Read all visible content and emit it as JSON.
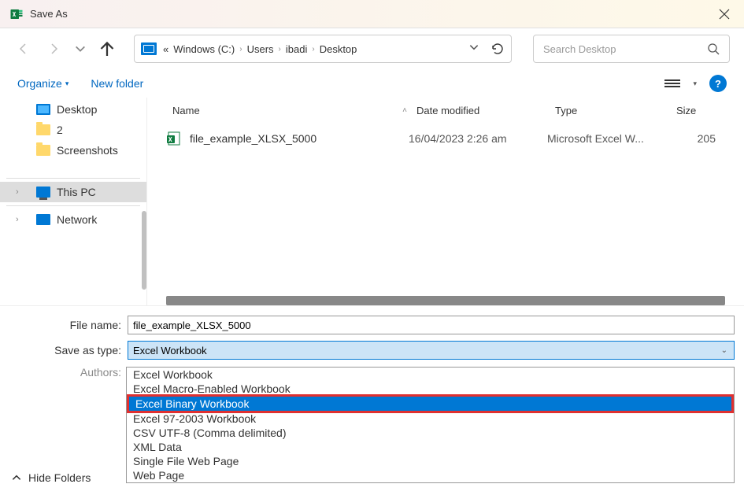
{
  "window": {
    "title": "Save As"
  },
  "nav": {
    "crumb_prefix": "«",
    "crumbs": [
      "Windows (C:)",
      "Users",
      "ibadi",
      "Desktop"
    ]
  },
  "search": {
    "placeholder": "Search Desktop"
  },
  "toolbar": {
    "organize": "Organize",
    "new_folder": "New folder"
  },
  "sidebar": {
    "items_top": [
      {
        "label": "Desktop",
        "icon": "desktop"
      },
      {
        "label": "2",
        "icon": "folder"
      },
      {
        "label": "Screenshots",
        "icon": "folder"
      }
    ],
    "items_bottom": [
      {
        "label": "This PC",
        "icon": "pc",
        "selected": true,
        "expand": true
      },
      {
        "label": "Network",
        "icon": "net",
        "expand": true
      }
    ]
  },
  "columns": {
    "name": "Name",
    "date": "Date modified",
    "type": "Type",
    "size": "Size"
  },
  "files": [
    {
      "name": "file_example_XLSX_5000",
      "date": "16/04/2023 2:26 am",
      "type": "Microsoft Excel W...",
      "size": "205"
    }
  ],
  "form": {
    "filename_label": "File name:",
    "filename_value": "file_example_XLSX_5000",
    "savetype_label": "Save as type:",
    "savetype_value": "Excel Workbook",
    "authors_label": "Authors:"
  },
  "dropdown": {
    "items": [
      "Excel Workbook",
      "Excel Macro-Enabled Workbook",
      "Excel Binary Workbook",
      "Excel 97-2003 Workbook",
      "CSV UTF-8 (Comma delimited)",
      "XML Data",
      "Single File Web Page",
      "Web Page"
    ],
    "highlighted_index": 2
  },
  "footer": {
    "hide_folders": "Hide Folders"
  },
  "help": {
    "label": "?"
  }
}
